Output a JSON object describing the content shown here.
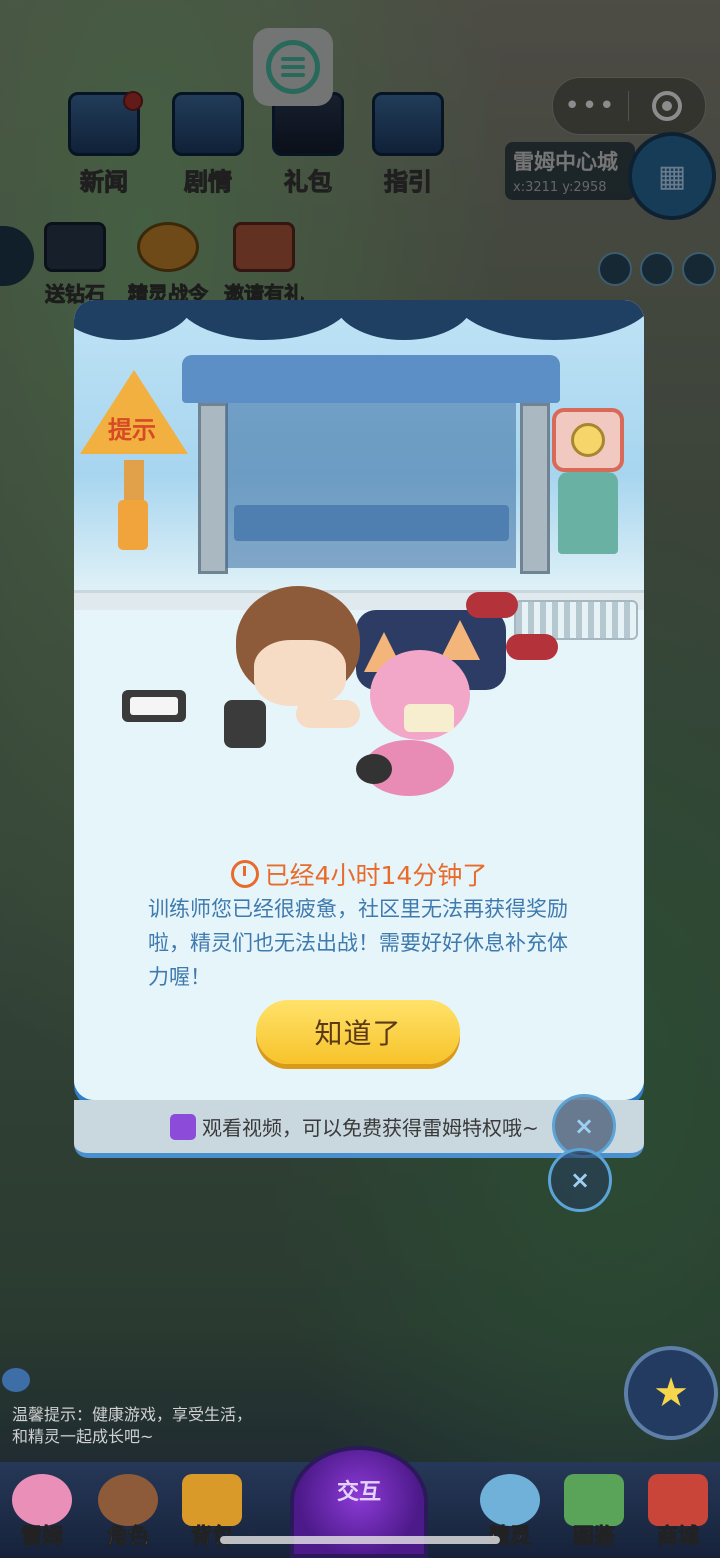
{
  "top_menu": {
    "news": "新闻",
    "story": "剧情",
    "gift": "礼包",
    "guide": "指引"
  },
  "location": {
    "city": "雷姆中心城",
    "coords": "x:3211 y:2958"
  },
  "row2": {
    "diamond": "送钻石",
    "battle_pass": "精灵战令",
    "invite": "邀请有礼"
  },
  "modal": {
    "sign": "提示",
    "time_text": "已经4小时14分钟了",
    "message": "训练师您已经很疲惫，社区里无法再获得奖励啦，精灵们也无法出战！需要好好休息补充体力喔！",
    "ok_button": "知道了"
  },
  "video_bar": {
    "text": "观看视频，可以免费获得雷姆特权哦~"
  },
  "close_icon": "×",
  "tip": {
    "line1": "温馨提示：健康游戏，享受生活，",
    "line2": "和精灵一起成长吧~"
  },
  "bottom_nav": {
    "leimu": "雷姆",
    "role": "角色",
    "bag": "背包",
    "interact": "交互",
    "spirit": "精灵",
    "catalog": "图鉴",
    "shop": "商城"
  },
  "colors": {
    "accent_orange": "#e86b2c",
    "message_blue": "#3f7aae",
    "button_yellow": "#f7c32b",
    "modal_border": "#2f7fc6"
  }
}
